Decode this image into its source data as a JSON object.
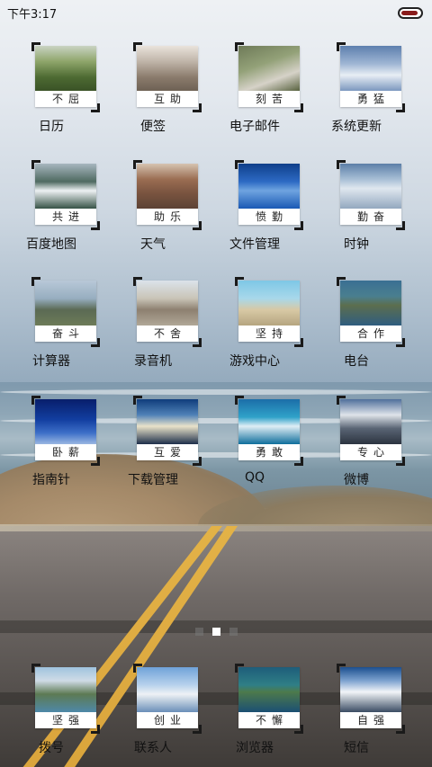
{
  "status_bar": {
    "time": "下午3:17",
    "battery_level": 0.9,
    "battery_color": "#8a1c1c"
  },
  "apps": [
    {
      "label": "日历",
      "caption": "不屈",
      "photo": "forest-plains"
    },
    {
      "label": "便签",
      "caption": "互助",
      "photo": "desert-mountains"
    },
    {
      "label": "电子邮件",
      "caption": "刻苦",
      "photo": "cliff-valley"
    },
    {
      "label": "系统更新",
      "caption": "勇猛",
      "photo": "clouds-mountain"
    },
    {
      "label": "百度地图",
      "caption": "共进",
      "photo": "aerial-clouds"
    },
    {
      "label": "天气",
      "caption": "助乐",
      "photo": "old-city"
    },
    {
      "label": "文件管理",
      "caption": "愤勤",
      "photo": "blue-ocean"
    },
    {
      "label": "时钟",
      "caption": "勤奋",
      "photo": "sky-clouds"
    },
    {
      "label": "计算器",
      "caption": "奋斗",
      "photo": "coast-hills"
    },
    {
      "label": "录音机",
      "caption": "不舍",
      "photo": "hillside-town"
    },
    {
      "label": "游戏中心",
      "caption": "坚持",
      "photo": "sunny-bay"
    },
    {
      "label": "电台",
      "caption": "合作",
      "photo": "sea-island"
    },
    {
      "label": "指南针",
      "caption": "卧薪",
      "photo": "deep-blue"
    },
    {
      "label": "下载管理",
      "caption": "互爱",
      "photo": "ocean-sunset"
    },
    {
      "label": "QQ",
      "caption": "勇敢",
      "photo": "ocean-wave"
    },
    {
      "label": "微博",
      "caption": "专心",
      "photo": "snow-alps"
    }
  ],
  "pager": {
    "count": 3,
    "active_index": 1
  },
  "dock": [
    {
      "label": "拨号",
      "caption": "坚强",
      "photo": "river-city"
    },
    {
      "label": "联系人",
      "caption": "创业",
      "photo": "blue-sky"
    },
    {
      "label": "浏览器",
      "caption": "不懈",
      "photo": "lagoon-island"
    },
    {
      "label": "短信",
      "caption": "自强",
      "photo": "snow-peaks"
    }
  ]
}
